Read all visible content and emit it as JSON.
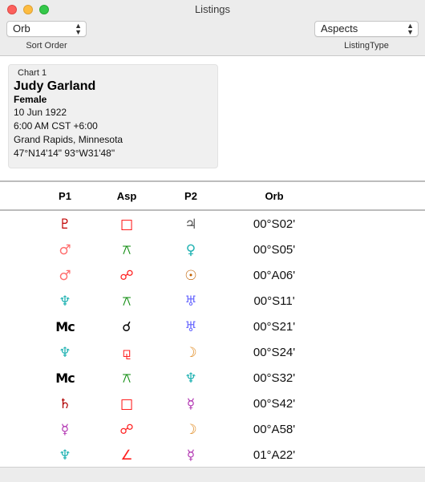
{
  "window": {
    "title": "Listings"
  },
  "toolbar": {
    "sort_popup": {
      "value": "Orb",
      "caption": "Sort Order"
    },
    "type_popup": {
      "value": "Aspects",
      "caption": "ListingType"
    }
  },
  "chart": {
    "header": "Chart 1",
    "name": "Judy Garland",
    "gender": "Female",
    "date": "10 Jun 1922",
    "time": "6:00 AM CST +6:00",
    "place": "Grand Rapids, Minnesota",
    "coords": "47°N14'14\" 93°W31'48\""
  },
  "table": {
    "headers": {
      "p1": "P1",
      "asp": "Asp",
      "p2": "P2",
      "orb": "Orb"
    },
    "rows": [
      {
        "p1": "♇",
        "p1_color": "#c00000",
        "asp": "□",
        "asp_color": "#ff0000",
        "p2": "♃",
        "p2_color": "#555555",
        "orb": "00°S02'"
      },
      {
        "p1": "♂",
        "p1_color": "#ff6f6f",
        "asp": "⚻",
        "asp_color": "#0a8a0a",
        "p2": "♀",
        "p2_color": "#20b2b2",
        "orb": "00°S05'"
      },
      {
        "p1": "♂",
        "p1_color": "#ff6f6f",
        "asp": "☍",
        "asp_color": "#ff2020",
        "p2": "☉",
        "p2_color": "#c06000",
        "orb": "00°A06'"
      },
      {
        "p1": "♆",
        "p1_color": "#20b2b2",
        "asp": "⚻",
        "asp_color": "#0a8a0a",
        "p2": "♅",
        "p2_color": "#6a6aff",
        "orb": "00°S11'"
      },
      {
        "p1": "Mc",
        "p1_color": "#000000",
        "asp": "☌",
        "asp_color": "#000000",
        "p2": "♅",
        "p2_color": "#6a6aff",
        "orb": "00°S21'"
      },
      {
        "p1": "♆",
        "p1_color": "#20b2b2",
        "asp": "⚼",
        "asp_color": "#ff2020",
        "p2": "☽",
        "p2_color": "#e08a20",
        "orb": "00°S24'"
      },
      {
        "p1": "Mc",
        "p1_color": "#000000",
        "asp": "⚻",
        "asp_color": "#0a8a0a",
        "p2": "♆",
        "p2_color": "#20b2b2",
        "orb": "00°S32'"
      },
      {
        "p1": "♄",
        "p1_color": "#b00000",
        "asp": "□",
        "asp_color": "#ff0000",
        "p2": "☿",
        "p2_color": "#b030b0",
        "orb": "00°S42'"
      },
      {
        "p1": "☿",
        "p1_color": "#b030b0",
        "asp": "☍",
        "asp_color": "#ff2020",
        "p2": "☽",
        "p2_color": "#e08a20",
        "orb": "00°A58'"
      },
      {
        "p1": "♆",
        "p1_color": "#20b2b2",
        "asp": "∠",
        "asp_color": "#ff2020",
        "p2": "☿",
        "p2_color": "#b030b0",
        "orb": "01°A22'"
      }
    ]
  }
}
